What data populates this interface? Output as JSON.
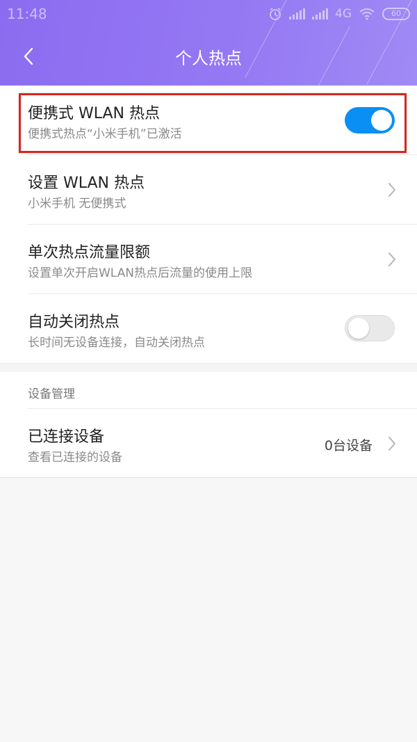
{
  "status_bar": {
    "time": "11:48",
    "network": "4G",
    "battery": "60",
    "icons": [
      "alarm-icon",
      "signal-icon",
      "signal-icon",
      "wifi-icon",
      "battery-icon"
    ]
  },
  "header": {
    "title": "个人热点",
    "back_icon": "chevron-left-icon",
    "gradient": [
      "#8b6cf0",
      "#a08af5"
    ]
  },
  "settings": [
    {
      "title": "便携式 WLAN 热点",
      "subtitle": "便携式热点“小米手机”已激活",
      "control": "switch",
      "on": true
    },
    {
      "title": "设置 WLAN 热点",
      "subtitle": "小米手机 无便携式",
      "control": "chevron"
    },
    {
      "title": "单次热点流量限额",
      "subtitle": "设置单次开启WLAN热点后流量的使用上限",
      "control": "chevron"
    },
    {
      "title": "自动关闭热点",
      "subtitle": "长时间无设备连接，自动关闭热点",
      "control": "switch",
      "on": false
    }
  ],
  "device_section": {
    "header": "设备管理",
    "item": {
      "title": "已连接设备",
      "subtitle": "查看已连接的设备",
      "value": "0台设备",
      "control": "chevron"
    }
  },
  "colors": {
    "accent": "#0a8ff4",
    "highlight": "#d9251c"
  }
}
